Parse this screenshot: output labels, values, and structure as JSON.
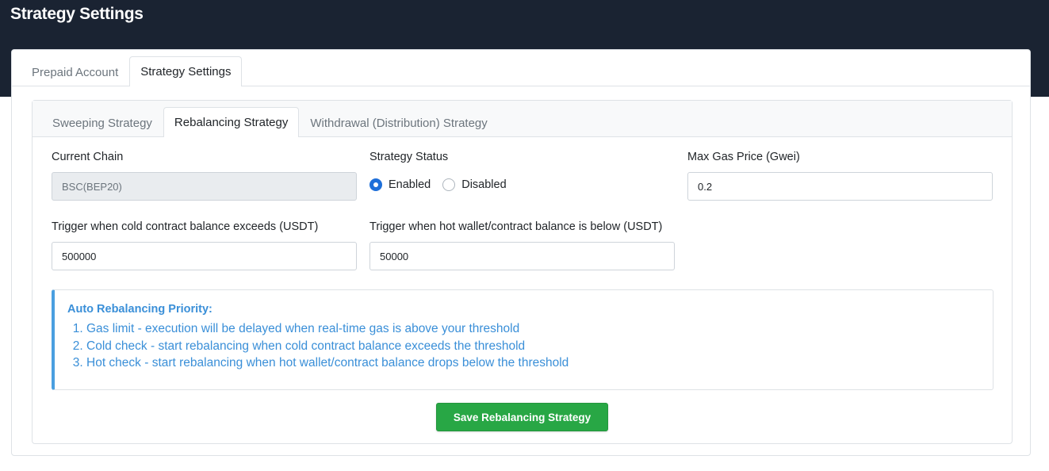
{
  "header": {
    "title": "Strategy Settings"
  },
  "outer_tabs": [
    {
      "label": "Prepaid Account",
      "active": false
    },
    {
      "label": "Strategy Settings",
      "active": true
    }
  ],
  "inner_tabs": [
    {
      "label": "Sweeping Strategy",
      "active": false
    },
    {
      "label": "Rebalancing Strategy",
      "active": true
    },
    {
      "label": "Withdrawal (Distribution) Strategy",
      "active": false
    }
  ],
  "form": {
    "current_chain": {
      "label": "Current Chain",
      "value": "BSC(BEP20)"
    },
    "strategy_status": {
      "label": "Strategy Status",
      "options": [
        {
          "label": "Enabled",
          "checked": true
        },
        {
          "label": "Disabled",
          "checked": false
        }
      ]
    },
    "max_gas_price": {
      "label": "Max Gas Price (Gwei)",
      "value": "0.2"
    },
    "cold_trigger": {
      "label": "Trigger when cold contract balance exceeds (USDT)",
      "value": "500000"
    },
    "hot_trigger": {
      "label": "Trigger when hot wallet/contract balance is below (USDT)",
      "value": "50000"
    }
  },
  "info": {
    "title": "Auto Rebalancing Priority:",
    "items": [
      "Gas limit - execution will be delayed when real-time gas is above your threshold",
      "Cold check - start rebalancing when cold contract balance exceeds the threshold",
      "Hot check - start rebalancing when hot wallet/contract balance drops below the threshold"
    ]
  },
  "actions": {
    "save_label": "Save Rebalancing Strategy"
  },
  "colors": {
    "header_bg": "#1a2332",
    "primary": "#1e6fd9",
    "info_text": "#3a8fd8",
    "success": "#28a745"
  }
}
